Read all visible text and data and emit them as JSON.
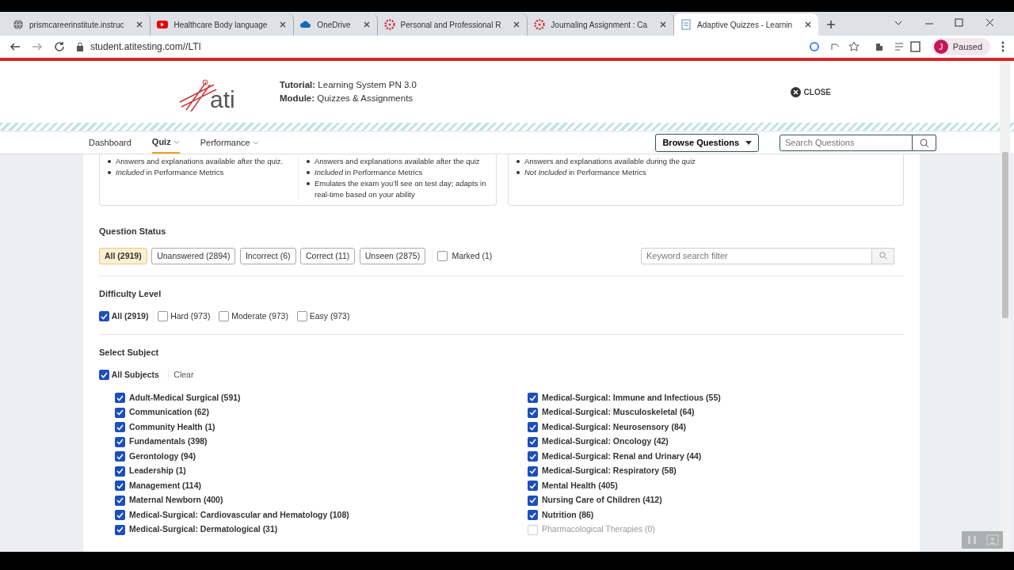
{
  "browser": {
    "tabs": [
      {
        "title": "prismcareerinstitute.instruc",
        "kind": "globe",
        "selected": false
      },
      {
        "title": "Healthcare Body language",
        "kind": "video",
        "selected": false
      },
      {
        "title": "OneDrive",
        "kind": "cloud",
        "selected": false
      },
      {
        "title": "Personal and Professional R",
        "kind": "canvas",
        "selected": false
      },
      {
        "title": "Journaling Assignment : Ca",
        "kind": "canvas",
        "selected": false
      },
      {
        "title": "Adaptive Quizzes - Learnin",
        "kind": "doc",
        "selected": true
      }
    ],
    "address": "student.atitesting.com//LTI",
    "profile": {
      "initial": "J",
      "label": "Paused"
    }
  },
  "header": {
    "logo": "ati",
    "tutorial_label": "Tutorial:",
    "tutorial_value": "Learning System PN 3.0",
    "module_label": "Module:",
    "module_value": "Quizzes & Assignments",
    "close": "CLOSE"
  },
  "nav": {
    "items": [
      {
        "label": "Dashboard",
        "selected": false,
        "dropdown": false
      },
      {
        "label": "Quiz",
        "selected": true,
        "dropdown": true
      },
      {
        "label": "Performance",
        "selected": false,
        "dropdown": true
      }
    ],
    "browse": "Browse Questions",
    "search_placeholder": "Search Questions"
  },
  "cards": [
    {
      "columns": [
        [
          "Answers and explanations available after the quiz.",
          "*Included* in Performance Metrics"
        ],
        [
          "Answers and explanations available after the quiz",
          "*Included* in Performance Metrics",
          "Emulates the exam you’ll see on test day; adapts in real-time based on your ability"
        ]
      ]
    },
    {
      "columns": [
        [
          "Answers and explanations available during the quiz",
          "*Not Included* in Performance Metrics"
        ]
      ]
    }
  ],
  "question_status": {
    "title": "Question Status",
    "filters": [
      {
        "kind": "pill",
        "label": "All (2919)",
        "selected": true
      },
      {
        "kind": "pill",
        "label": "Unanswered (2894)",
        "selected": false
      },
      {
        "kind": "pill",
        "label": "Incorrect (6)",
        "selected": false
      },
      {
        "kind": "pill",
        "label": "Correct (11)",
        "selected": false
      },
      {
        "kind": "pill",
        "label": "Unseen (2875)",
        "selected": false
      },
      {
        "kind": "checkbox",
        "label": "Marked (1)",
        "selected": false
      }
    ],
    "keyword_placeholder": "Keyword search filter"
  },
  "difficulty": {
    "title": "Difficulty Level",
    "options": [
      {
        "label": "All (2919)",
        "checked": true
      },
      {
        "label": "Hard (973)",
        "checked": false
      },
      {
        "label": "Moderate (973)",
        "checked": false
      },
      {
        "label": "Easy (973)",
        "checked": false
      }
    ]
  },
  "subject": {
    "title": "Select Subject",
    "all": {
      "label": "All Subjects",
      "checked": true
    },
    "clear": "Clear",
    "columns": [
      [
        {
          "label": "Adult-Medical Surgical (591)",
          "checked": true,
          "disabled": false
        },
        {
          "label": "Communication (62)",
          "checked": true,
          "disabled": false
        },
        {
          "label": "Community Health (1)",
          "checked": true,
          "disabled": false
        },
        {
          "label": "Fundamentals (398)",
          "checked": true,
          "disabled": false
        },
        {
          "label": "Gerontology (94)",
          "checked": true,
          "disabled": false
        },
        {
          "label": "Leadership (1)",
          "checked": true,
          "disabled": false
        },
        {
          "label": "Management (114)",
          "checked": true,
          "disabled": false
        },
        {
          "label": "Maternal Newborn (400)",
          "checked": true,
          "disabled": false
        },
        {
          "label": "Medical-Surgical: Cardiovascular and Hematology (108)",
          "checked": true,
          "disabled": false
        },
        {
          "label": "Medical-Surgical: Dermatological (31)",
          "checked": true,
          "disabled": false
        }
      ],
      [
        {
          "label": "Medical-Surgical: Immune and Infectious (55)",
          "checked": true,
          "disabled": false
        },
        {
          "label": "Medical-Surgical: Musculoskeletal (64)",
          "checked": true,
          "disabled": false
        },
        {
          "label": "Medical-Surgical: Neurosensory (84)",
          "checked": true,
          "disabled": false
        },
        {
          "label": "Medical-Surgical: Oncology (42)",
          "checked": true,
          "disabled": false
        },
        {
          "label": "Medical-Surgical: Renal and Urinary (44)",
          "checked": true,
          "disabled": false
        },
        {
          "label": "Medical-Surgical: Respiratory (58)",
          "checked": true,
          "disabled": false
        },
        {
          "label": "Mental Health (405)",
          "checked": true,
          "disabled": false
        },
        {
          "label": "Nursing Care of Children (412)",
          "checked": true,
          "disabled": false
        },
        {
          "label": "Nutrition (86)",
          "checked": true,
          "disabled": false
        },
        {
          "label": "Pharmacological Therapies (0)",
          "checked": false,
          "disabled": true
        }
      ]
    ]
  }
}
